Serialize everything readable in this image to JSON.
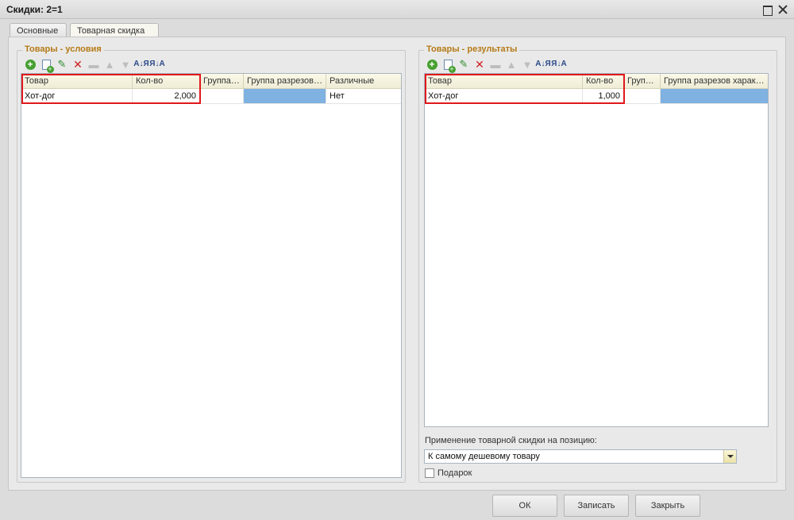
{
  "window": {
    "title": "Скидки: 2=1"
  },
  "tabs": [
    {
      "label": "Основные"
    },
    {
      "label": "Товарная скидка"
    }
  ],
  "conditions": {
    "title": "Товары - условия",
    "columns": [
      "Товар",
      "Кол-во",
      "Группа т...",
      "Группа разрезов х...",
      "Различные"
    ],
    "rows": [
      {
        "product": "Хот-дог",
        "qty": "2,000",
        "group": "",
        "cut_group": "",
        "different": "Нет"
      }
    ]
  },
  "results": {
    "title": "Товары - результаты",
    "columns": [
      "Товар",
      "Кол-во",
      "Группа...",
      "Группа разрезов характ..."
    ],
    "rows": [
      {
        "product": "Хот-дог",
        "qty": "1,000",
        "group": "",
        "cut_group": ""
      }
    ]
  },
  "apply": {
    "label": "Применение товарной скидки на позицию:",
    "value": "К самому дешевому товару"
  },
  "gift": {
    "label": "Подарок",
    "checked": false
  },
  "footer": {
    "ok": "ОК",
    "save": "Записать",
    "close": "Закрыть"
  },
  "colors": {
    "accent_title": "#b57a16",
    "highlight": "#e0181b",
    "selected_cell": "#7fb2e0"
  }
}
